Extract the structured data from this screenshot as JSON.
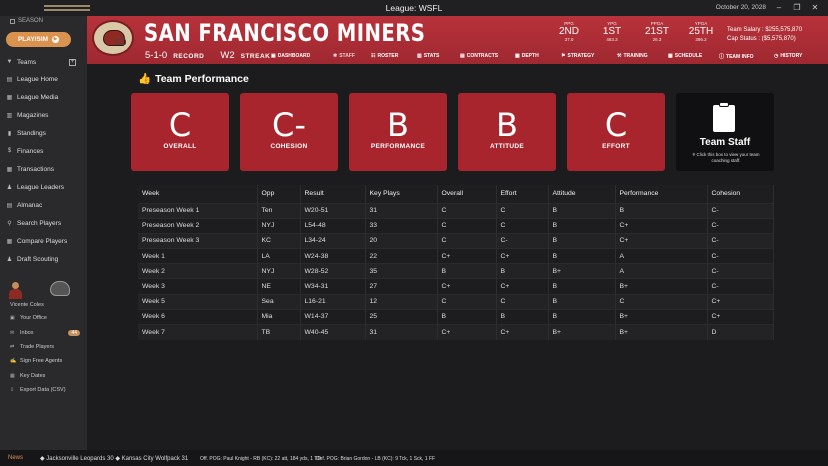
{
  "window": {
    "title": "League: WSFL",
    "date": "October 20, 2028"
  },
  "sidebar": {
    "season": "SEASON",
    "play_sim": "PLAY/SIM",
    "items": [
      {
        "label": "Teams",
        "icon": "shirt-icon"
      },
      {
        "label": "League Home",
        "icon": "home-icon"
      },
      {
        "label": "League Media",
        "icon": "media-icon"
      },
      {
        "label": "Magazines",
        "icon": "magazine-icon"
      },
      {
        "label": "Standings",
        "icon": "chart-icon"
      },
      {
        "label": "Finances",
        "icon": "dollar-icon"
      },
      {
        "label": "Transactions",
        "icon": "transactions-icon"
      },
      {
        "label": "League Leaders",
        "icon": "leaders-icon"
      },
      {
        "label": "Almanac",
        "icon": "book-icon"
      },
      {
        "label": "Search Players",
        "icon": "search-icon"
      },
      {
        "label": "Compare Players",
        "icon": "compare-icon"
      },
      {
        "label": "Draft Scouting",
        "icon": "draft-icon"
      }
    ],
    "username": "Vicente Coles",
    "sub_items": [
      {
        "label": "Your Office",
        "icon": "office-icon"
      },
      {
        "label": "Inbox",
        "icon": "inbox-icon",
        "badge": "44"
      },
      {
        "label": "Trade Players",
        "icon": "trade-icon"
      },
      {
        "label": "Sign Free Agents",
        "icon": "sign-icon"
      },
      {
        "label": "Key Dates",
        "icon": "calendar-icon"
      },
      {
        "label": "Export Data (CSV)",
        "icon": "export-icon"
      }
    ]
  },
  "header": {
    "team_name": "SAN FRANCISCO MINERS",
    "record_value": "5-1-0",
    "record_label": "RECORD",
    "streak_value": "W2",
    "streak_label": "STREAK",
    "stats": [
      {
        "label": "PPG",
        "rank": "2ND",
        "value": "37.0"
      },
      {
        "label": "YPG",
        "rank": "1ST",
        "value": "463.3"
      },
      {
        "label": "PPGA",
        "rank": "21ST",
        "value": "26.3"
      },
      {
        "label": "YPGA",
        "rank": "25TH",
        "value": "396.2"
      }
    ],
    "team_salary": "Team Salary : $255,575,870",
    "cap_status": "Cap Status : ($5,575,870)",
    "nav": [
      "DASHBOARD",
      "STAFF",
      "ROSTER",
      "STATS",
      "CONTRACTS",
      "DEPTH",
      "STRATEGY",
      "TRAINING",
      "SCHEDULE",
      "TEAM INFO",
      "HISTORY"
    ]
  },
  "main": {
    "title": "Team Performance",
    "cards": [
      {
        "grade": "C",
        "label": "OVERALL"
      },
      {
        "grade": "C-",
        "label": "COHESION"
      },
      {
        "grade": "B",
        "label": "PERFORMANCE"
      },
      {
        "grade": "B",
        "label": "ATTITUDE"
      },
      {
        "grade": "C",
        "label": "EFFORT"
      }
    ],
    "staff": {
      "title": "Team Staff",
      "subtitle": "Click this box to view your team coaching staff."
    },
    "columns": [
      "Week",
      "Opp",
      "Result",
      "Key Plays",
      "Overall",
      "Effort",
      "Attitude",
      "Performance",
      "Cohesion"
    ],
    "rows": [
      [
        "Preseason Week 1",
        "Ten",
        "W20-51",
        "31",
        "C",
        "C",
        "B",
        "B",
        "C-"
      ],
      [
        "Preseason Week 2",
        "NYJ",
        "L54-48",
        "33",
        "C",
        "C",
        "B",
        "C+",
        "C-"
      ],
      [
        "Preseason Week 3",
        "KC",
        "L34-24",
        "20",
        "C",
        "C-",
        "B",
        "C+",
        "C-"
      ],
      [
        "Week 1",
        "LA",
        "W24-38",
        "22",
        "C+",
        "C+",
        "B",
        "A",
        "C-"
      ],
      [
        "Week 2",
        "NYJ",
        "W28-52",
        "35",
        "B",
        "B",
        "B+",
        "A",
        "C-"
      ],
      [
        "Week 3",
        "NE",
        "W34-31",
        "27",
        "C+",
        "C+",
        "B",
        "B+",
        "C-"
      ],
      [
        "Week 5",
        "Sea",
        "L16-21",
        "12",
        "C",
        "C",
        "B",
        "C",
        "C+"
      ],
      [
        "Week 6",
        "Mia",
        "W14-37",
        "25",
        "B",
        "B",
        "B",
        "B+",
        "C+"
      ],
      [
        "Week 7",
        "TB",
        "W40-45",
        "31",
        "C+",
        "C+",
        "B+",
        "B+",
        "D"
      ]
    ]
  },
  "ticker": {
    "label": "News",
    "game": "Jacksonville Leopards 30",
    "game2": "Kansas City Wolfpack 31",
    "off_pog": "Off. POG: Paul Knight - RB (KC): 22 att, 184 yds, 1 TD",
    "def_pog": "Def. POG: Brian Gordon - LB (KC): 9 Tck, 1 Sck, 1 FF"
  }
}
